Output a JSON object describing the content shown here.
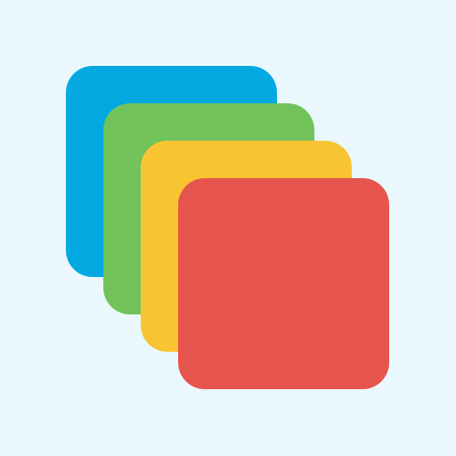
{
  "background_color": "#eaf8fd",
  "icon": "stacked-squares-icon",
  "layers": [
    {
      "name": "blue-layer",
      "color": "#03a9e0"
    },
    {
      "name": "green-layer",
      "color": "#71c35a"
    },
    {
      "name": "yellow-layer",
      "color": "#f8c432"
    },
    {
      "name": "red-layer",
      "color": "#e6554d"
    }
  ]
}
